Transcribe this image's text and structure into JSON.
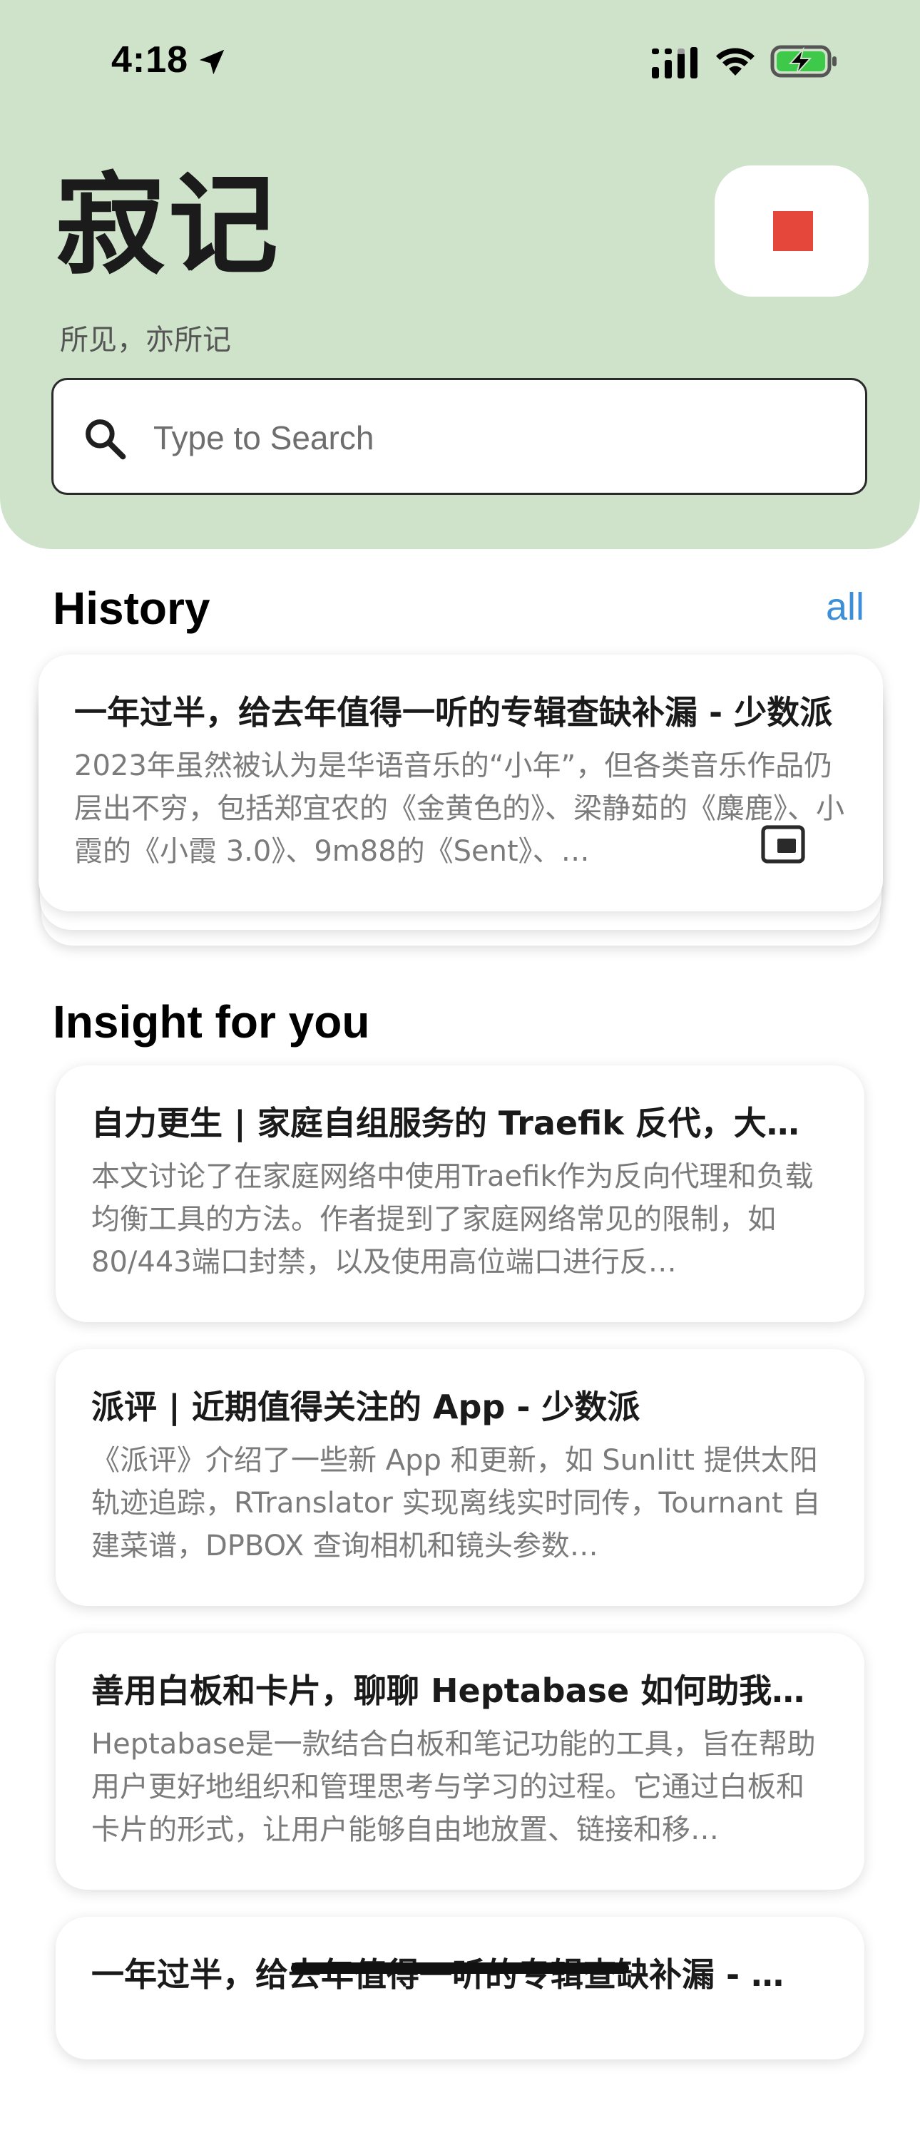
{
  "status_bar": {
    "time": "4:18"
  },
  "header": {
    "title": "寂记",
    "subtitle": "所见，亦所记"
  },
  "search": {
    "placeholder": "Type to Search",
    "value": ""
  },
  "history": {
    "title": "History",
    "all_label": "all",
    "cards": [
      {
        "title": "一年过半，给去年值得一听的专辑查缺补漏 - 少数派",
        "body": "2023年虽然被认为是华语音乐的“小年”，但各类音乐作品仍层出不穷，包括郑宜农的《金黄色的》、梁静茹的《麋鹿》、小霞的《小霞 3.0》、9m88的《Sent》、…"
      }
    ]
  },
  "insight": {
    "title": "Insight for you",
    "cards": [
      {
        "title": "自力更生 | 家庭自组服务的 Traefik 反代，大…",
        "body": " 本文讨论了在家庭网络中使用Traefik作为反向代理和负载均衡工具的方法。作者提到了家庭网络常见的限制，如80/443端口封禁，以及使用高位端口进行反…"
      },
      {
        "title": "派评 | 近期值得关注的 App - 少数派",
        "body": "《派评》介绍了一些新 App 和更新，如 Sunlitt 提供太阳轨迹追踪，RTranslator 实现离线实时同传，Tournant 自建菜谱，DPBOX 查询相机和镜头参数…"
      },
      {
        "title": "善用白板和卡片，聊聊 Heptabase 如何助我…",
        "body": "Heptabase是一款结合白板和笔记功能的工具，旨在帮助用户更好地组织和管理思考与学习的过程。它通过白板和卡片的形式，让用户能够自由地放置、链接和移…"
      },
      {
        "title": "一年过半，给去年值得一听的专辑查缺补漏 - …",
        "body": ""
      }
    ]
  },
  "colors": {
    "header_bg": "#cfe3cb",
    "record_stop": "#e5483a",
    "link": "#3d8fd8"
  },
  "icons": {
    "location": "location-arrow-icon",
    "signal": "cellular-signal-icon",
    "wifi": "wifi-icon",
    "battery": "battery-charging-icon",
    "search": "search-icon",
    "stop": "stop-icon",
    "pip": "picture-in-picture-icon"
  }
}
